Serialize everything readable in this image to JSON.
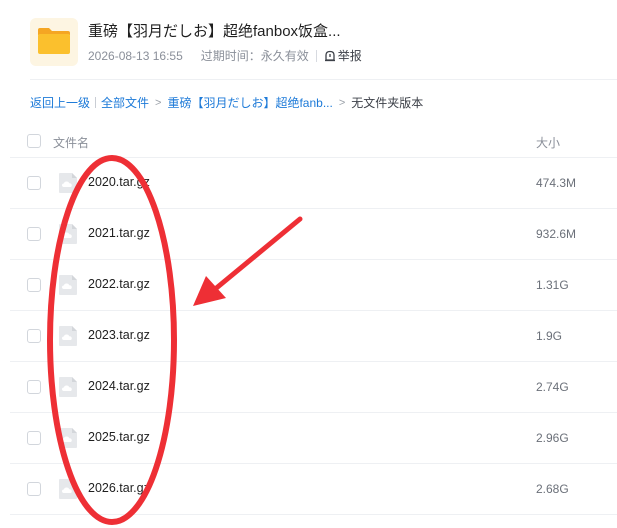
{
  "share": {
    "title": "重磅【羽月だしお】超绝fanbox饭盒...",
    "date": "2026-08-13 16:55",
    "expire_label": "过期时间：",
    "expire_value": "永久有效",
    "report_label": "举报"
  },
  "breadcrumb": {
    "back": "返回上一级",
    "all_files": "全部文件",
    "parent": "重磅【羽月だしお】超绝fanb...",
    "current": "无文件夹版本",
    "arrow": ">"
  },
  "table": {
    "col_name": "文件名",
    "col_size": "大小",
    "rows": [
      {
        "name": "2020.tar.gz",
        "size": "474.3M"
      },
      {
        "name": "2021.tar.gz",
        "size": "932.6M"
      },
      {
        "name": "2022.tar.gz",
        "size": "1.31G"
      },
      {
        "name": "2023.tar.gz",
        "size": "1.9G"
      },
      {
        "name": "2024.tar.gz",
        "size": "2.74G"
      },
      {
        "name": "2025.tar.gz",
        "size": "2.96G"
      },
      {
        "name": "2026.tar.gz",
        "size": "2.68G"
      }
    ]
  },
  "icons": {
    "folder": "folder-icon",
    "report": "report-icon",
    "file": "cloud-file-icon"
  },
  "colors": {
    "link": "#1d7ad8",
    "folder": "#f7b731",
    "annotation": "#ee2f35"
  }
}
